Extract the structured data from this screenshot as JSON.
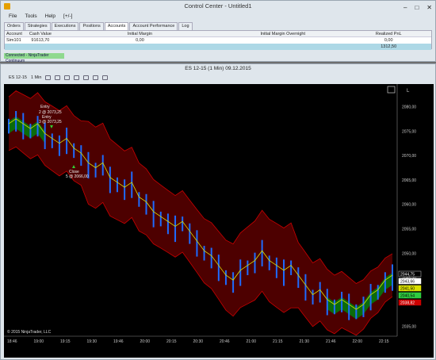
{
  "control_center": {
    "title": "Control Center - Untitled1",
    "menu": [
      "File",
      "Tools",
      "Help",
      "[+/-]"
    ],
    "tabs": [
      "Orders",
      "Strategies",
      "Executions",
      "Positions",
      "Accounts",
      "Account Performance",
      "Log"
    ],
    "active_tab": "Accounts",
    "grid": {
      "headers": [
        "Account",
        "Cash Value",
        "Initial Margin",
        "Initial Margin Overnight",
        "Realized PnL"
      ],
      "rows": [
        [
          "Sim101",
          "91613,70",
          "0,00",
          "",
          "0,00"
        ]
      ],
      "total": [
        "",
        "",
        "",
        "",
        "1312,50"
      ]
    },
    "status": "Connected - NinjaTrader Continuum",
    "window_buttons": [
      "–",
      "□",
      "✕"
    ]
  },
  "chart_window": {
    "title": "ES 12-15 (1 Min)  09.12.2015",
    "instrument": "ES 12-15",
    "interval": "1 Min",
    "copyright": "© 2015 NinjaTrader, LLC",
    "button_l": "L",
    "price_labels": [
      "2080,00",
      "2075,00",
      "2070,00",
      "2065,00",
      "2060,00",
      "2055,00",
      "2050,00",
      "2045,00",
      "2040,00",
      "2035,00"
    ],
    "time_labels": [
      "18:46",
      "19:00",
      "19:15",
      "19:30",
      "19:46",
      "20:00",
      "20:15",
      "20:30",
      "20:46",
      "21:00",
      "21:15",
      "21:30",
      "21:46",
      "22:00",
      "22:15"
    ],
    "right_badges": [
      {
        "text": "2044,75",
        "color": "#ffffff",
        "bg": "#000000",
        "border": "#cccccc"
      },
      {
        "text": "2043,66",
        "color": "#000000",
        "bg": "#ffffff",
        "border": "#ffffff"
      },
      {
        "text": "2041,50",
        "color": "#000000",
        "bg": "#d9e000",
        "border": "#d9e000"
      },
      {
        "text": "2040,54",
        "color": "#000000",
        "bg": "#2ecc40",
        "border": "#2ecc40"
      },
      {
        "text": "2038,82",
        "color": "#ffffff",
        "bg": "#cc0000",
        "border": "#cc0000"
      }
    ],
    "annotations": [
      {
        "text": "Entry"
      },
      {
        "text": "2 @ 2073,25"
      },
      {
        "text": "Entry"
      },
      {
        "text": "3 @ 2073,25"
      },
      {
        "text": "Close"
      },
      {
        "text": "5 @ 2066,00"
      }
    ]
  },
  "chart_data": {
    "type": "line",
    "price_range": [
      2033,
      2083
    ],
    "colors": {
      "bars": "#1e6bff",
      "channel_fill": "#5a0000",
      "channel_line": "#cc0000",
      "mid_line": "#d9e000",
      "cloud_up": "#0b6b0b"
    },
    "close": [
      2076,
      2077,
      2076,
      2075,
      2076,
      2074,
      2073,
      2072,
      2073,
      2071,
      2070,
      2068,
      2067,
      2068,
      2065,
      2064,
      2063,
      2064,
      2061,
      2060,
      2058,
      2057,
      2056,
      2055,
      2056,
      2054,
      2052,
      2050,
      2049,
      2047,
      2045,
      2044,
      2046,
      2047,
      2048,
      2050,
      2048,
      2047,
      2046,
      2047,
      2045,
      2043,
      2041,
      2042,
      2040,
      2039,
      2040,
      2039,
      2038,
      2039,
      2041,
      2042,
      2044,
      2045
    ]
  }
}
